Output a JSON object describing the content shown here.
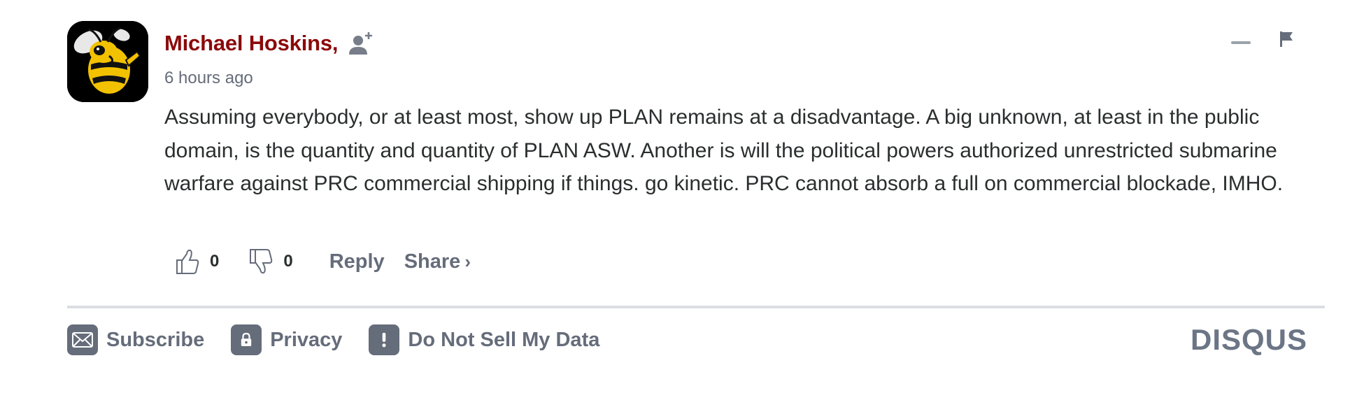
{
  "comment": {
    "author": "Michael Hoskins,",
    "timestamp": "6 hours ago",
    "body": "Assuming everybody, or at least most, show up PLAN remains at a disadvantage. A big unknown, at least in the public domain, is the quantity and quantity of PLAN ASW. Another is will the political powers authorized unrestricted submarine warfare against PRC commercial shipping if things. go kinetic. PRC cannot absorb a full on commercial blockade, IMHO.",
    "avatar_icon": "yellow-jacket-mascot-avatar",
    "follow_icon": "add-user-icon",
    "upvotes": "0",
    "downvotes": "0",
    "reply_label": "Reply",
    "share_label": "Share",
    "share_chevron": "›"
  },
  "controls": {
    "collapse_icon": "minus-icon",
    "flag_icon": "flag-icon"
  },
  "footer": {
    "subscribe_label": "Subscribe",
    "privacy_label": "Privacy",
    "do_not_sell_label": "Do Not Sell My Data",
    "brand": "DISQUS"
  },
  "colors": {
    "author": "#8b0a0a",
    "muted": "#656c7a",
    "text": "#2a2e2e",
    "divider": "#dcdee3"
  }
}
